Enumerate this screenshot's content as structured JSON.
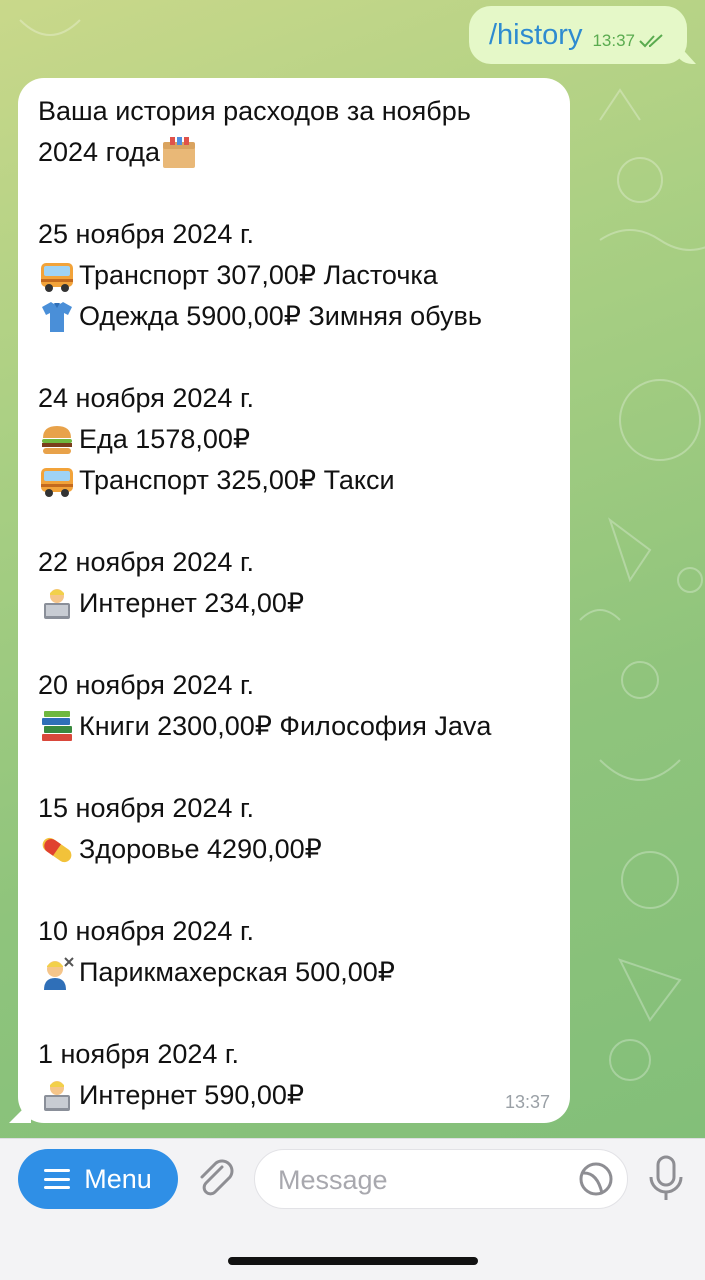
{
  "outgoing": {
    "text": "/history",
    "time": "13:37"
  },
  "incoming": {
    "title_line1": "Ваша история расходов за ноябрь",
    "title_line2": "2024 года",
    "title_icon": "box-icon",
    "days": [
      {
        "date": "25 ноября 2024 г.",
        "items": [
          {
            "icon": "bus-icon",
            "text": "Транспорт 307,00₽ Ласточка"
          },
          {
            "icon": "shirt-icon",
            "text": "Одежда 5900,00₽ Зимняя обувь"
          }
        ]
      },
      {
        "date": "24 ноября 2024 г.",
        "items": [
          {
            "icon": "burger-icon",
            "text": "Еда 1578,00₽"
          },
          {
            "icon": "bus-icon",
            "text": "Транспорт 325,00₽ Такси"
          }
        ]
      },
      {
        "date": "22 ноября 2024 г.",
        "items": [
          {
            "icon": "laptop-person-icon",
            "text": "Интернет 234,00₽"
          }
        ]
      },
      {
        "date": "20 ноября 2024 г.",
        "items": [
          {
            "icon": "books-icon",
            "text": "Книги 2300,00₽ Философия Java"
          }
        ]
      },
      {
        "date": "15 ноября 2024 г.",
        "items": [
          {
            "icon": "pill-icon",
            "text": "Здоровье 4290,00₽"
          }
        ]
      },
      {
        "date": "10 ноября 2024 г.",
        "items": [
          {
            "icon": "haircut-icon",
            "text": "Парикмахерская 500,00₽"
          }
        ]
      },
      {
        "date": "1 ноября 2024 г.",
        "items": [
          {
            "icon": "laptop-person-icon",
            "text": "Интернет 590,00₽"
          }
        ]
      }
    ],
    "time": "13:37"
  },
  "input_bar": {
    "menu_label": "Menu",
    "placeholder": "Message"
  },
  "colors": {
    "accent": "#2f8fe6",
    "outgoing_bubble": "#e5f8c8",
    "link": "#2e8bd0"
  }
}
